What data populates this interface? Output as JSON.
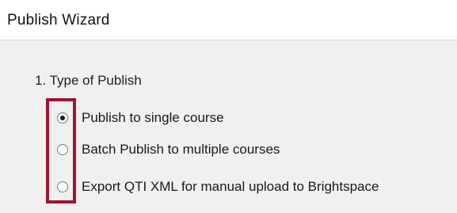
{
  "window": {
    "title": "Publish Wizard"
  },
  "section": {
    "heading": "1.  Type of Publish"
  },
  "publish_options": [
    {
      "label": "Publish to single course",
      "selected": true
    },
    {
      "label": "Batch Publish to multiple courses",
      "selected": false
    },
    {
      "label": "Export QTI XML for manual upload to Brightspace",
      "selected": false
    }
  ],
  "colors": {
    "highlight_border": "#9e1530",
    "panel_background": "#f0f0f0",
    "titlebar_background": "#ffffff"
  }
}
